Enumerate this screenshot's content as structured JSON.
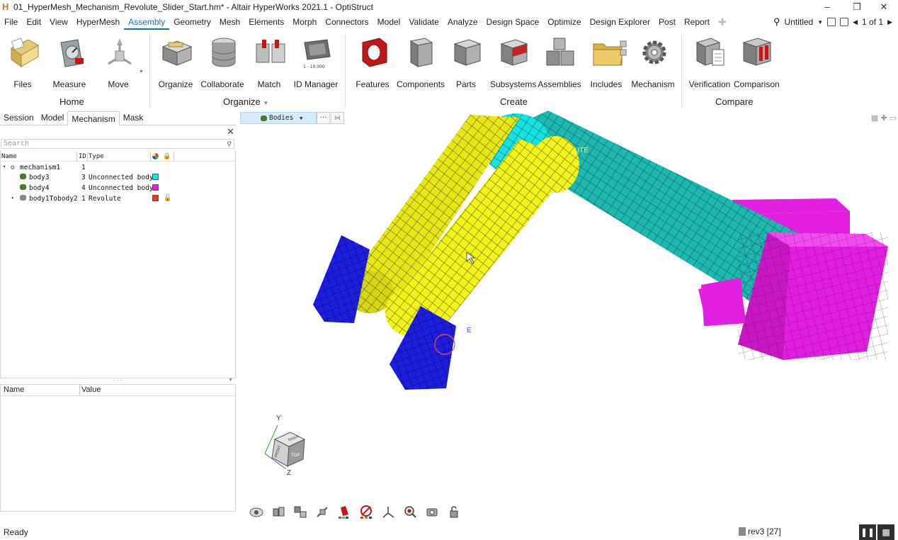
{
  "window": {
    "logo": "H",
    "title": "01_HyperMesh_Mechanism_Revolute_Slider_Start.hm* - Altair HyperWorks 2021.1 - OptiStruct",
    "minimize": "–",
    "restore": "❐",
    "close": "✕"
  },
  "menu": {
    "items": [
      "File",
      "Edit",
      "View",
      "HyperMesh",
      "Assembly",
      "Geometry",
      "Mesh",
      "Elements",
      "Morph",
      "Connectors",
      "Model",
      "Validate",
      "Analyze",
      "Design Space",
      "Optimize",
      "Design Explorer",
      "Post",
      "Report"
    ],
    "active": "Assembly",
    "plus": "✚",
    "session_name": "Untitled",
    "page_nav": "1 of 1"
  },
  "ribbon": {
    "groups": {
      "home": "Home",
      "organize": "Organize",
      "create": "Create",
      "compare": "Compare"
    },
    "tools": {
      "files": "Files",
      "measure": "Measure",
      "move": "Move",
      "organize": "Organize",
      "collaborate": "Collaborate",
      "match": "Match",
      "id_manager": "ID Manager",
      "id_manager_sub": "1 - 10,000",
      "features": "Features",
      "components": "Components",
      "parts": "Parts",
      "subsystems": "Subsystems",
      "assemblies": "Assemblies",
      "includes": "Includes",
      "mechanism": "Mechanism",
      "verification": "Verification",
      "comparison": "Comparison"
    },
    "colors": {
      "features": "#c0171b",
      "includes": "#d9b24a"
    }
  },
  "panel": {
    "tabs": [
      "Session",
      "Model",
      "Mechanism",
      "Mask"
    ],
    "active_tab": "Mechanism",
    "search_placeholder": "Search",
    "columns": {
      "name": "Name",
      "id": "ID",
      "type": "Type"
    },
    "rows": [
      {
        "name": "mechanism1",
        "id": "1",
        "type": "",
        "color": ""
      },
      {
        "name": "body3",
        "id": "3",
        "type": "Unconnected body",
        "color": "#18e1e1"
      },
      {
        "name": "body4",
        "id": "4",
        "type": "Unconnected body",
        "color": "#e81fe0"
      },
      {
        "name": "body1Tobody2",
        "id": "1",
        "type": "Revolute",
        "color": "#e03a2a"
      }
    ],
    "props": {
      "name": "Name",
      "value": "Value"
    }
  },
  "viewport": {
    "entity_selector": "Bodies",
    "selector_more": "···",
    "labels": {
      "revolute": "UTE",
      "e_label": "E"
    },
    "axes": {
      "y": "Y",
      "z": "Z"
    },
    "view_cube": {
      "top": "TOP",
      "front": "FRONT",
      "right": "RIGHT"
    },
    "colors": {
      "yellow": "#f2f21c",
      "teal": "#1eb8b0",
      "magenta": "#e21ee0",
      "blue": "#1e1ee0"
    }
  },
  "status": {
    "text": "Ready",
    "revision": "rev3 [27]"
  }
}
